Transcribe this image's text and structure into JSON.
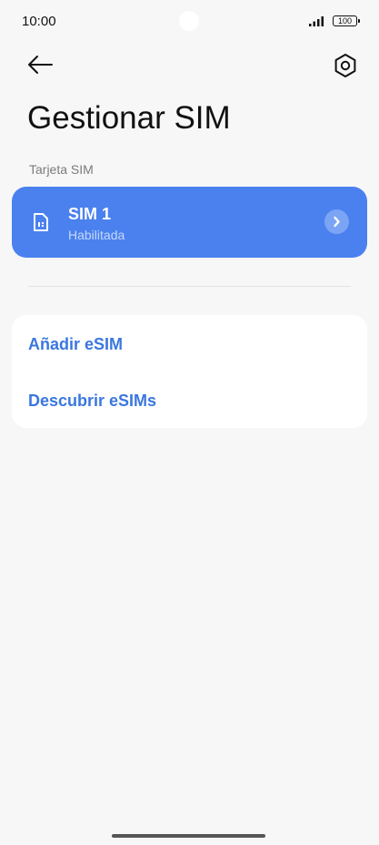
{
  "status_bar": {
    "time": "10:00",
    "battery": "100",
    "icons": [
      "signal-icon",
      "battery-icon"
    ]
  },
  "toolbar": {
    "back_icon": "back-arrow-icon",
    "settings_icon": "settings-hexagon-icon"
  },
  "page": {
    "title": "Gestionar SIM",
    "section_label": "Tarjeta SIM"
  },
  "sim_card": {
    "name": "SIM 1",
    "status": "Habilitada",
    "icon": "sim-card-icon",
    "chevron_icon": "chevron-right-icon",
    "color": "#4a81ef"
  },
  "esim": {
    "add_label": "Añadir eSIM",
    "discover_label": "Descubrir eSIMs",
    "link_color": "#3a77de"
  }
}
